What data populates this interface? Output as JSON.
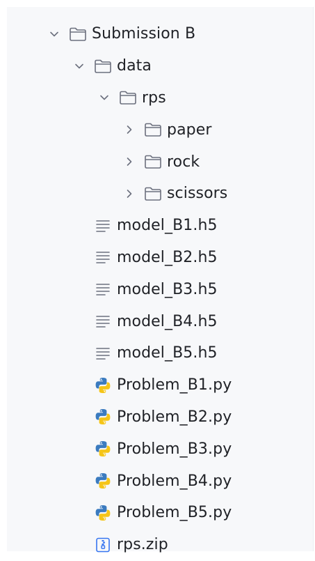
{
  "colors": {
    "panel_bg": "#f7f8fa",
    "text": "#1f2126",
    "icon_stroke": "#6c707e",
    "python_blue": "#3b7bbf",
    "python_yellow": "#f5c518",
    "zip_blue": "#3574f0"
  },
  "tree": [
    {
      "label": "Submission B",
      "depth": 0,
      "kind": "folder",
      "state": "expanded",
      "icon": "folder-icon"
    },
    {
      "label": "data",
      "depth": 1,
      "kind": "folder",
      "state": "expanded",
      "icon": "folder-icon"
    },
    {
      "label": "rps",
      "depth": 2,
      "kind": "folder",
      "state": "expanded",
      "icon": "folder-icon"
    },
    {
      "label": "paper",
      "depth": 3,
      "kind": "folder",
      "state": "collapsed",
      "icon": "folder-icon"
    },
    {
      "label": "rock",
      "depth": 3,
      "kind": "folder",
      "state": "collapsed",
      "icon": "folder-icon"
    },
    {
      "label": "scissors",
      "depth": 3,
      "kind": "folder",
      "state": "collapsed",
      "icon": "folder-icon"
    },
    {
      "label": "model_B1.h5",
      "depth": 1,
      "kind": "file",
      "icon": "text-file-icon"
    },
    {
      "label": "model_B2.h5",
      "depth": 1,
      "kind": "file",
      "icon": "text-file-icon"
    },
    {
      "label": "model_B3.h5",
      "depth": 1,
      "kind": "file",
      "icon": "text-file-icon"
    },
    {
      "label": "model_B4.h5",
      "depth": 1,
      "kind": "file",
      "icon": "text-file-icon"
    },
    {
      "label": "model_B5.h5",
      "depth": 1,
      "kind": "file",
      "icon": "text-file-icon"
    },
    {
      "label": "Problem_B1.py",
      "depth": 1,
      "kind": "file",
      "icon": "python-file-icon"
    },
    {
      "label": "Problem_B2.py",
      "depth": 1,
      "kind": "file",
      "icon": "python-file-icon"
    },
    {
      "label": "Problem_B3.py",
      "depth": 1,
      "kind": "file",
      "icon": "python-file-icon"
    },
    {
      "label": "Problem_B4.py",
      "depth": 1,
      "kind": "file",
      "icon": "python-file-icon"
    },
    {
      "label": "Problem_B5.py",
      "depth": 1,
      "kind": "file",
      "icon": "python-file-icon"
    },
    {
      "label": "rps.zip",
      "depth": 1,
      "kind": "file",
      "icon": "zip-file-icon"
    }
  ]
}
